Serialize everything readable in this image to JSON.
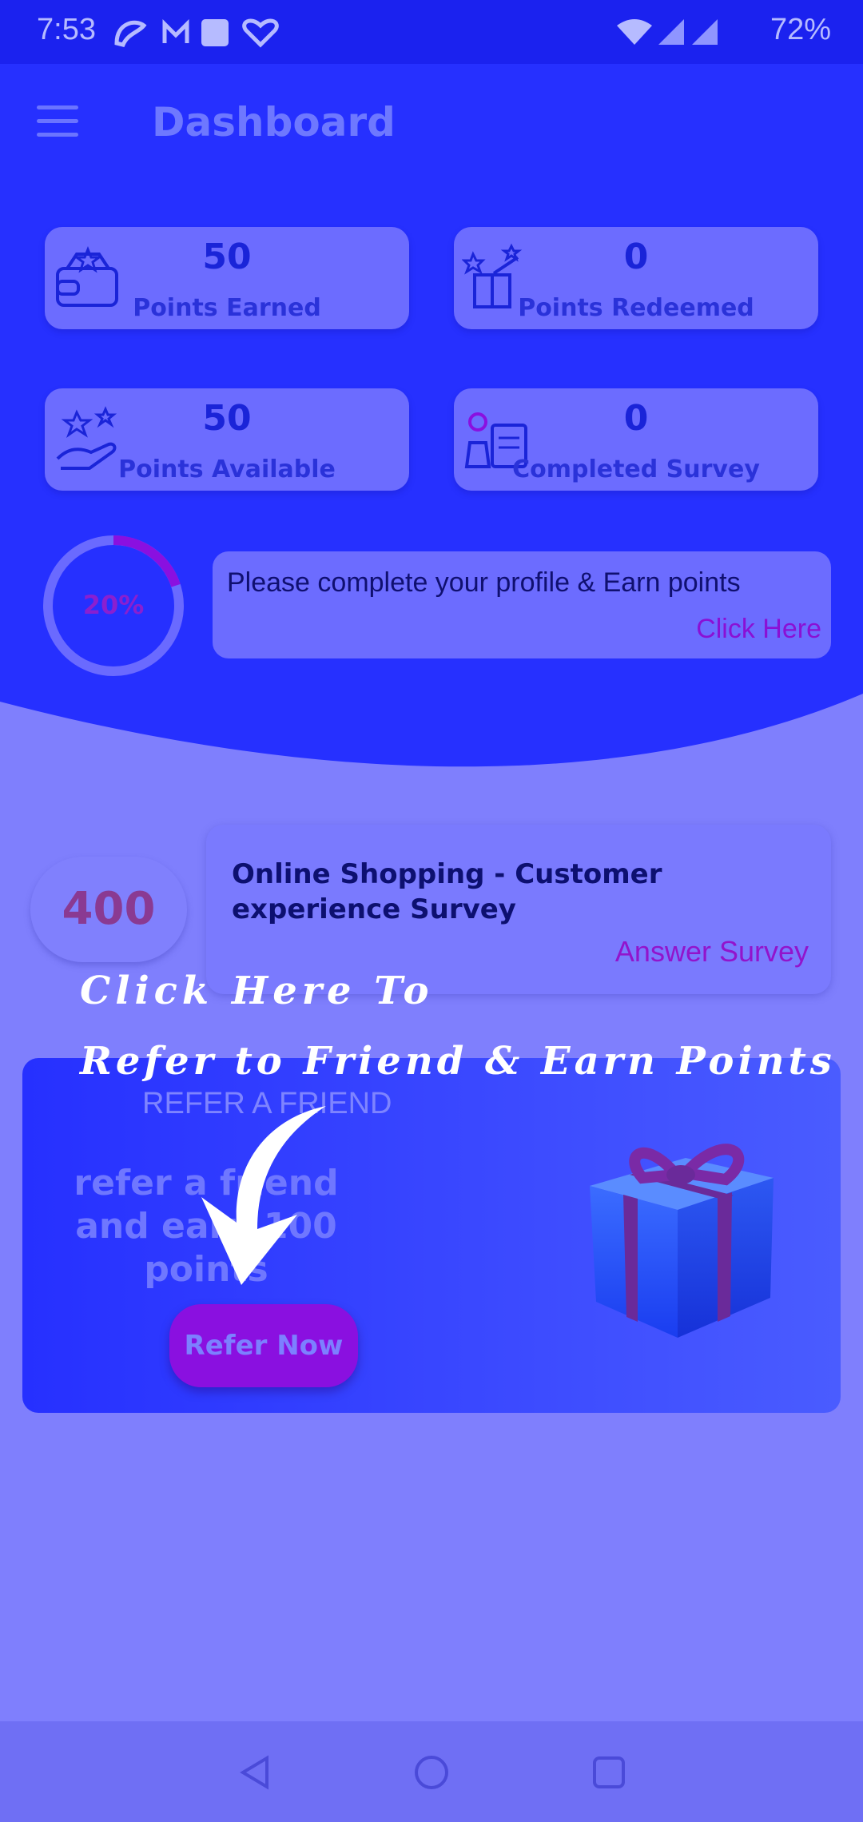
{
  "status_bar": {
    "time": "7:53",
    "battery": "72%"
  },
  "header": {
    "title": "Dashboard"
  },
  "stats": [
    {
      "value": "50",
      "label": "Points Earned",
      "icon": "wallet-icon"
    },
    {
      "value": "0",
      "label": "Points Redeemed",
      "icon": "gift-box-icon"
    },
    {
      "value": "50",
      "label": "Points Available",
      "icon": "hand-stars-icon"
    },
    {
      "value": "0",
      "label": "Completed Survey",
      "icon": "survey-clipboard-icon"
    }
  ],
  "profile": {
    "progress_text": "20%",
    "progress_fraction": 0.2,
    "message": "Please complete your profile & Earn points",
    "link": "Click Here"
  },
  "survey": {
    "points": "400",
    "title": "Online Shopping - Customer experience Survey",
    "link": "Answer Survey"
  },
  "refer": {
    "heading": "REFER A FRIEND",
    "body": "refer a friend and earn 100 points",
    "button": "Refer Now"
  },
  "overlay": {
    "line1": "Click Here To",
    "line2": "Refer to Friend & Earn Points"
  },
  "colors": {
    "header_bg": "#2630ff",
    "page_bg": "#7f7ffd",
    "accent_purple": "#8a10e0"
  }
}
